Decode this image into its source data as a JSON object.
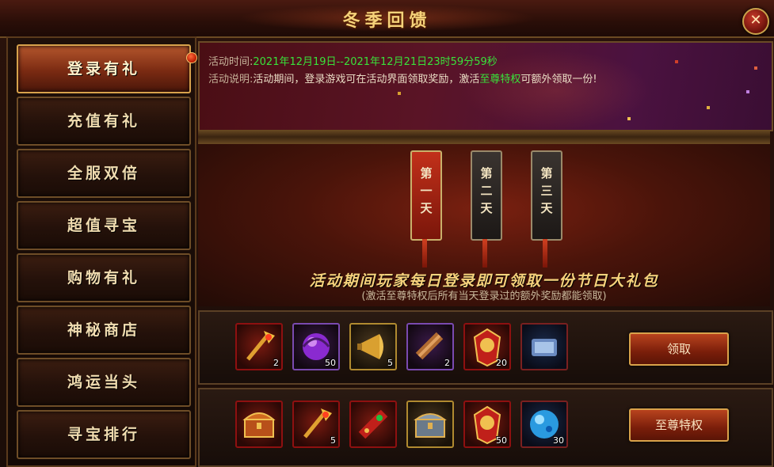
{
  "window": {
    "title": "冬季回馈",
    "close_label": "✕"
  },
  "sidebar": {
    "items": [
      {
        "label": "登录有礼",
        "active": true
      },
      {
        "label": "充值有礼",
        "active": false
      },
      {
        "label": "全服双倍",
        "active": false
      },
      {
        "label": "超值寻宝",
        "active": false
      },
      {
        "label": "购物有礼",
        "active": false
      },
      {
        "label": "神秘商店",
        "active": false
      },
      {
        "label": "鸿运当头",
        "active": false
      },
      {
        "label": "寻宝排行",
        "active": false
      }
    ]
  },
  "info": {
    "time_label": "活动时间:",
    "time_value": "2021年12月19日--2021年12月21日23时59分59秒",
    "desc_label": "活动说明:",
    "desc_part1": "活动期间，登录游戏可在活动界面领取奖励，激活",
    "desc_highlight": "至尊特权",
    "desc_part2": "可额外领取一份!"
  },
  "days": {
    "day1": "第一天",
    "day2": "第二天",
    "day3": "第三天"
  },
  "main": {
    "headline": "活动期间玩家每日登录即可领取一份节日大礼包",
    "subline": "(激活至尊特权后所有当天登录过的额外奖励都能领取)"
  },
  "rewards": {
    "row1": {
      "items": [
        {
          "icon": "golden-axe-icon",
          "qty": "2"
        },
        {
          "icon": "purple-orb-icon",
          "qty": "50"
        },
        {
          "icon": "horn-icon",
          "qty": "5"
        },
        {
          "icon": "scroll-icon",
          "qty": "2"
        },
        {
          "icon": "talisman-icon",
          "qty": "20"
        },
        {
          "icon": "blue-scroll-icon",
          "qty": ""
        }
      ],
      "button_label": "领取"
    },
    "row2": {
      "items": [
        {
          "icon": "treasure-chest-icon",
          "qty": ""
        },
        {
          "icon": "golden-axe-icon",
          "qty": "5"
        },
        {
          "icon": "red-scroll-icon",
          "qty": ""
        },
        {
          "icon": "silver-chest-icon",
          "qty": ""
        },
        {
          "icon": "talisman-icon",
          "qty": "50"
        },
        {
          "icon": "blue-orb-icon",
          "qty": "30"
        }
      ],
      "button_label": "至尊特权"
    }
  }
}
